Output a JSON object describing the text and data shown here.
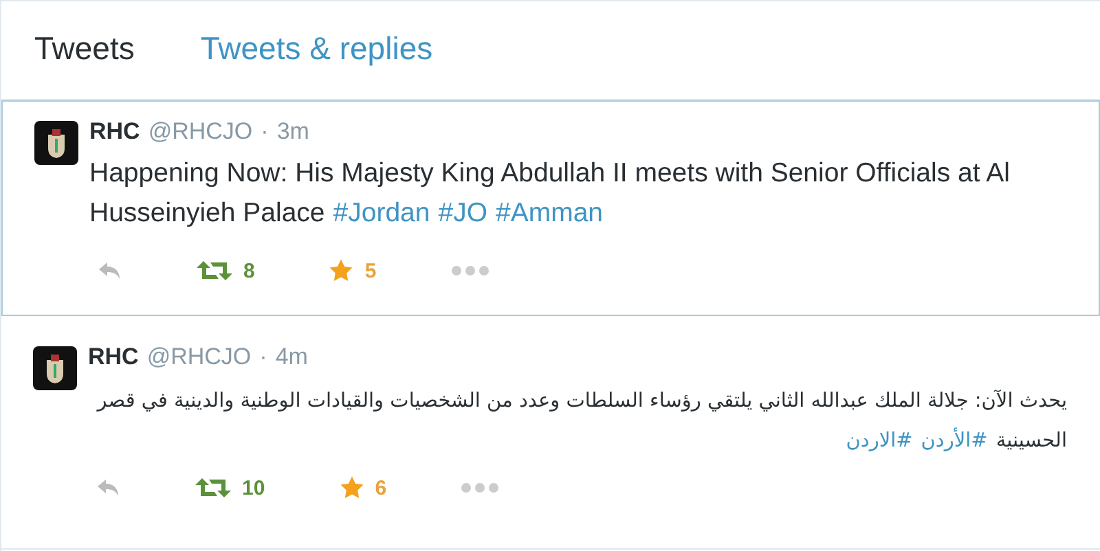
{
  "tabs": [
    {
      "label": "Tweets",
      "selected": true
    },
    {
      "label": "Tweets & replies",
      "selected": false
    }
  ],
  "tweets": [
    {
      "selected": true,
      "name": "RHC",
      "handle": "@RHCJO",
      "sep": "·",
      "time": "3m",
      "rtl": false,
      "text": "Happening Now: His Majesty King Abdullah II meets with Senior Officials at Al Husseinyieh Palace",
      "hashtags": [
        "#Jordan",
        "#JO",
        "#Amman"
      ],
      "retweeted": true,
      "retweets": "8",
      "favorited": true,
      "favorites": "5"
    },
    {
      "selected": false,
      "name": "RHC",
      "handle": "@RHCJO",
      "sep": "·",
      "time": "4m",
      "rtl": true,
      "text": "يحدث الآن: جلالة الملك عبدالله الثاني يلتقي رؤساء السلطات وعدد من الشخصيات والقيادات الوطنية والدينية في قصر الحسينية",
      "hashtags": [
        "#الأردن",
        "#الاردن"
      ],
      "retweeted": true,
      "retweets": "10",
      "favorited": true,
      "favorites": "6"
    }
  ]
}
